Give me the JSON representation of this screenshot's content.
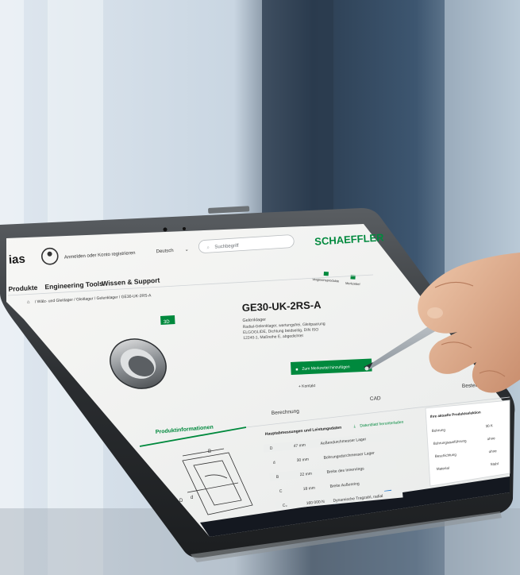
{
  "header": {
    "brand_fragment": "ias",
    "login_label": "Anmelden oder Konto registrieren",
    "language": "Deutsch",
    "search_placeholder": "Suchbegriff",
    "logo": "SCHAEFFLER",
    "header_icon_labels": [
      "Vergleichsprodukte",
      "Merkzettel"
    ]
  },
  "nav": {
    "items": [
      "Produkte",
      "Engineering Tools",
      "Wissen & Support"
    ]
  },
  "breadcrumb": "/ Wälz- und Gleitlager / Gleitlager / Gelenklager / GE30-UK-2RS-A",
  "product": {
    "title": "GE30-UK-2RS-A",
    "subtitle": "Gelenklager",
    "description_lines": [
      "Radial-Gelenklager, wartungsfrei, Gleitpaarung",
      "ELGOGLIDE, Dichtung beidseitig, DIN ISO",
      "12240-1, Maßreihe E, abgedichtet"
    ],
    "badge": "3D",
    "cta_label": "Zum Merkzettel hinzufügen",
    "secondary_link": "+ Kontakt"
  },
  "tabs": [
    "Produktinformationen",
    "Berechnung",
    "CAD",
    "Bestellung"
  ],
  "specs": {
    "heading": "Hauptabmessungen und Leistungsdaten",
    "download": "Datenblatt herunterladen",
    "rows": [
      {
        "symbol": "D",
        "value": "47 mm",
        "label": "Außendurchmesser Lager"
      },
      {
        "symbol": "d",
        "value": "30 mm",
        "label": "Bohrungsdurchmesser Lager"
      },
      {
        "symbol": "B",
        "value": "22 mm",
        "label": "Breite des Innenrings"
      },
      {
        "symbol": "C",
        "value": "18 mm",
        "label": "Breite Außenring"
      },
      {
        "symbol": "C₀",
        "value": "160 000 N",
        "label": "Dynamische Tragzahl, radial"
      }
    ]
  },
  "side_panel": {
    "heading": "Ihre aktuelle Produktselektion",
    "rows": [
      {
        "key": "Bohrung",
        "value": "30 K"
      },
      {
        "key": "Bohrungsausführung",
        "value": "ohne"
      },
      {
        "key": "Beschichtung",
        "value": "ohne"
      },
      {
        "key": "Material",
        "value": "Stahl"
      }
    ]
  },
  "colors": {
    "brand_green": "#00893d",
    "tablet_frame": "#2a2d30",
    "skin": "#e4b595"
  }
}
